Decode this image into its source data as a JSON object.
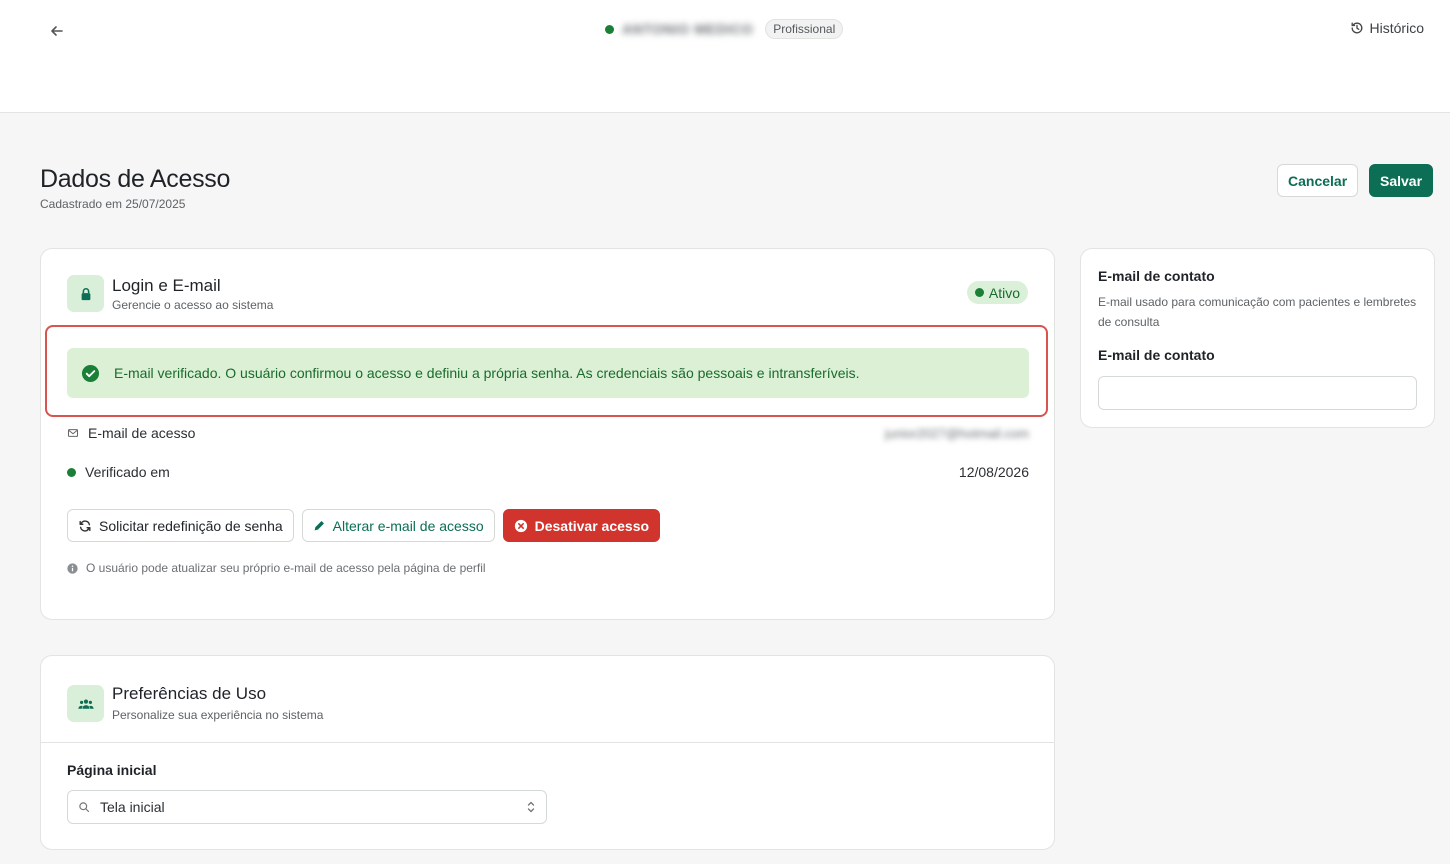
{
  "header": {
    "user_name": "ANTONIO MEDICO",
    "role": "Profissional",
    "history_label": "Histórico"
  },
  "page": {
    "title": "Dados de Acesso",
    "subtitle": "Cadastrado em 25/07/2025",
    "cancel_label": "Cancelar",
    "save_label": "Salvar"
  },
  "login_card": {
    "title": "Login e E-mail",
    "description": "Gerencie o acesso ao sistema",
    "status": "Ativo",
    "alert": "E-mail verificado. O usuário confirmou o acesso e definiu a própria senha. As credenciais são pessoais e intransferíveis.",
    "email_label": "E-mail de acesso",
    "email_value": "junior2027@hotmail.com",
    "verified_label": "Verificado em",
    "verified_value": "12/08/2026",
    "reset_label": "Solicitar redefinição de senha",
    "change_label": "Alterar e-mail de acesso",
    "deactivate_label": "Desativar acesso",
    "hint": "O usuário pode atualizar seu próprio e-mail de acesso pela página de perfil"
  },
  "contact_card": {
    "title": "E-mail de contato",
    "description": "E-mail usado para comunicação com pacientes e lembretes de consulta",
    "field_label": "E-mail de contato",
    "field_value": ""
  },
  "prefs_card": {
    "title": "Preferências de Uso",
    "description": "Personalize sua experiência no sistema",
    "home_label": "Página inicial",
    "home_value": "Tela inicial"
  },
  "colors": {
    "brand": "#0b6e55",
    "success": "#1a7f37",
    "success_bg": "#dcf0d6",
    "danger": "#d0342c",
    "highlight": "#d9534f"
  }
}
